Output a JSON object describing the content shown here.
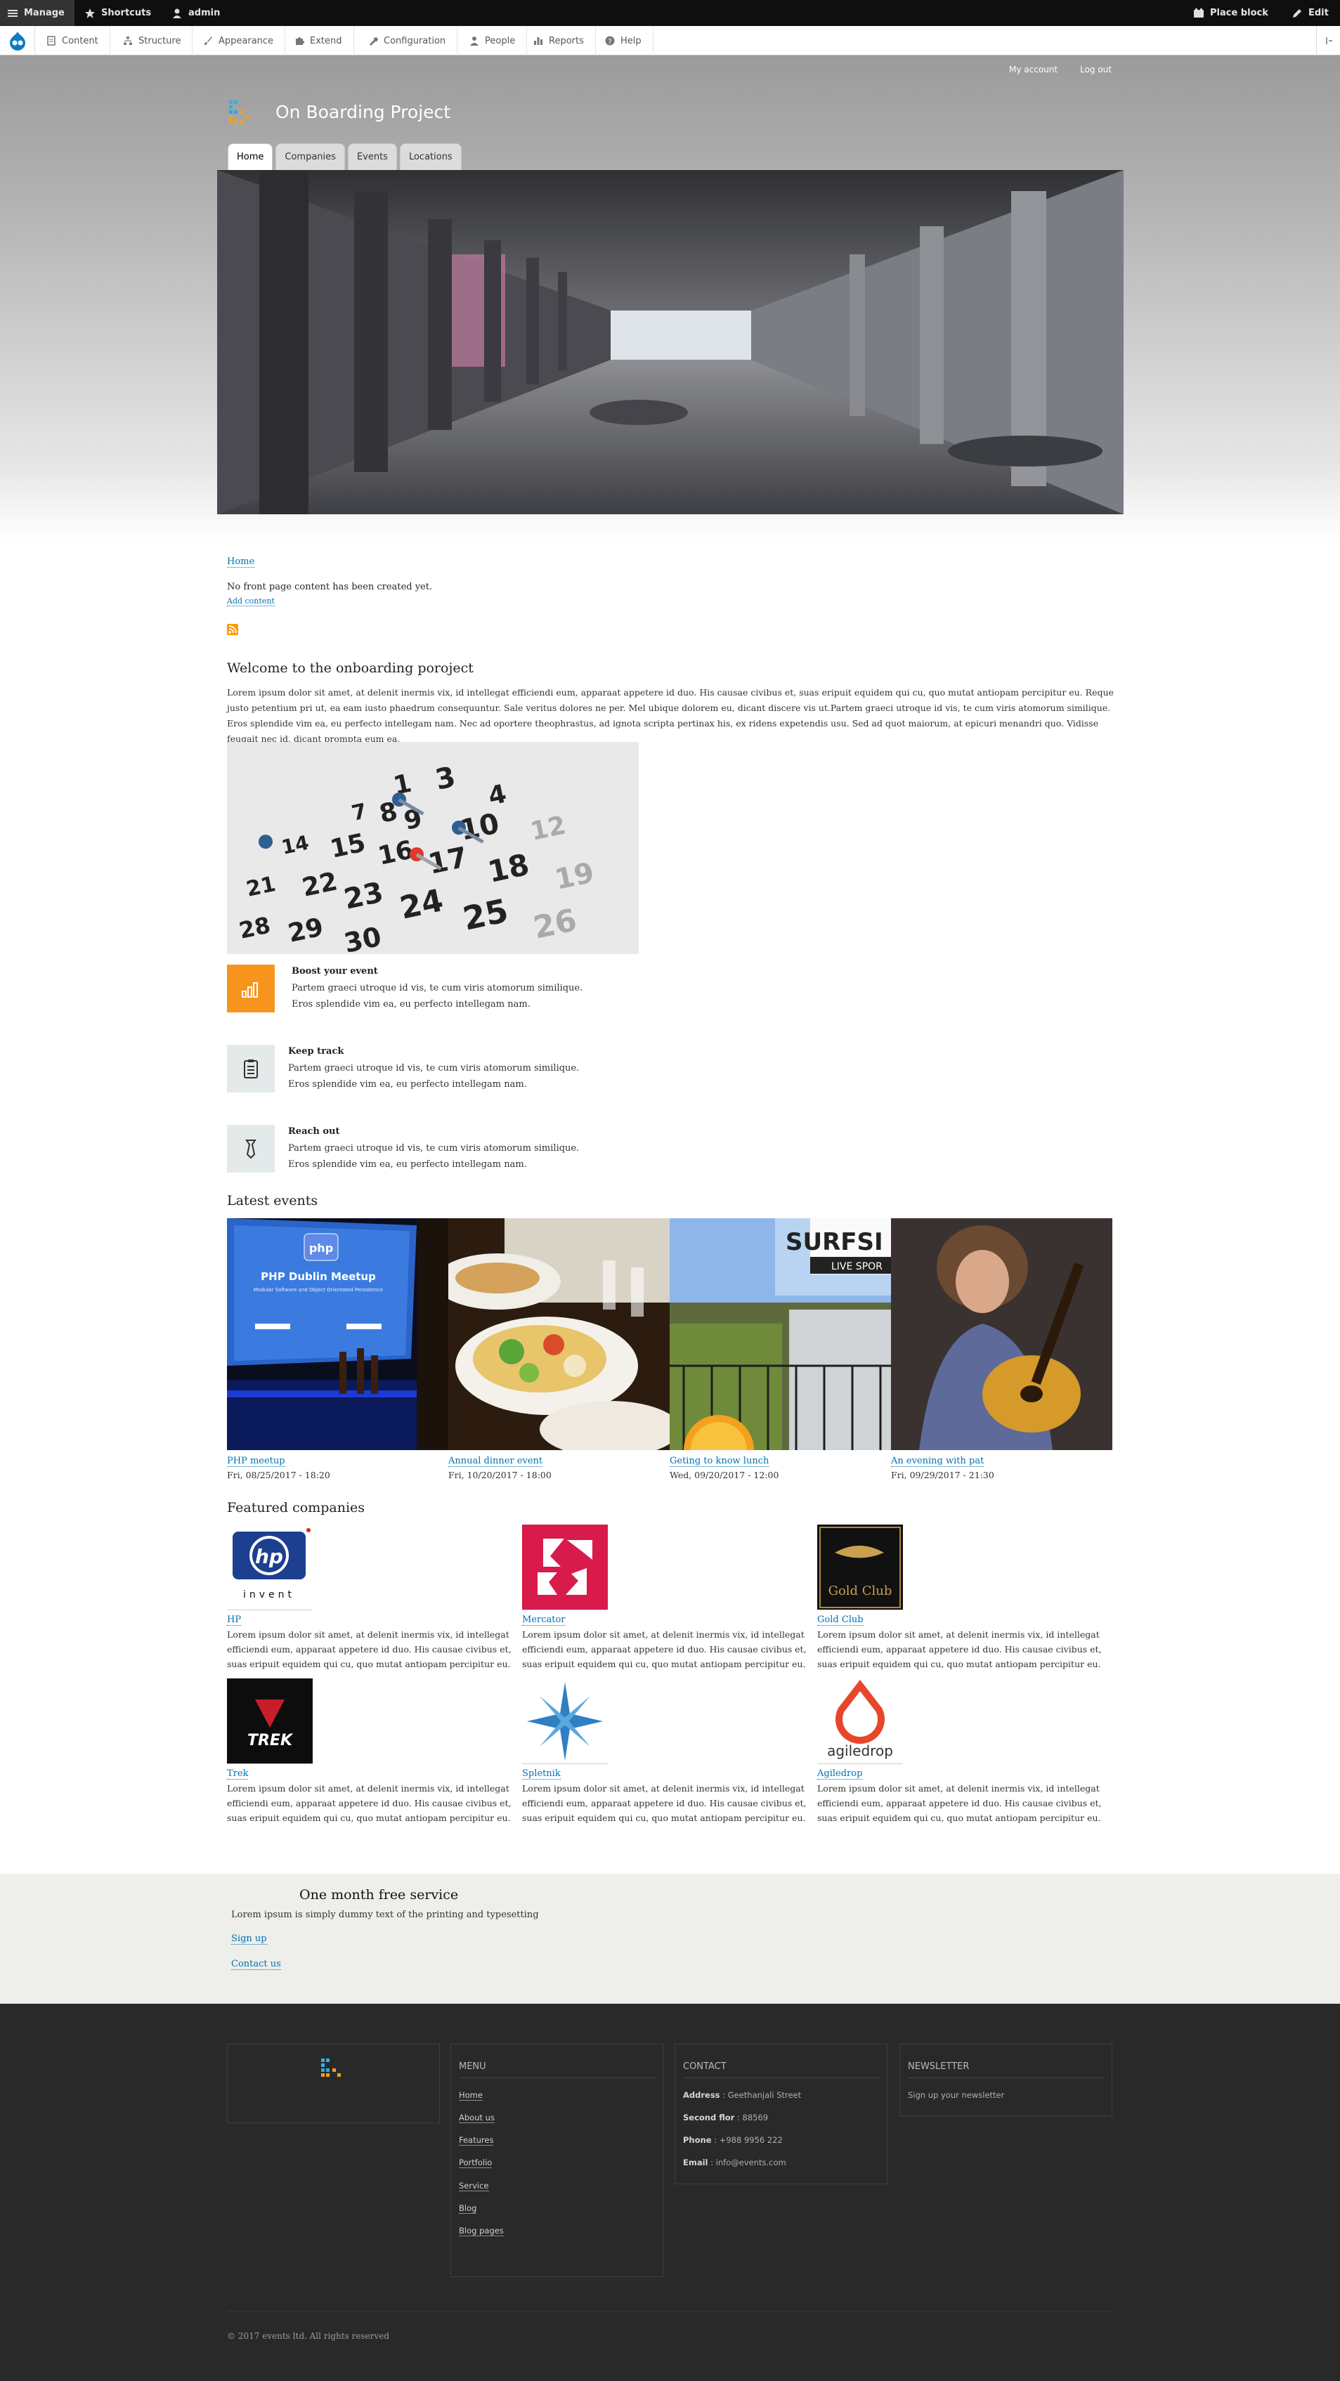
{
  "toolbar": {
    "manage": "Manage",
    "shortcuts": "Shortcuts",
    "user": "admin",
    "place_block": "Place block",
    "edit": "Edit"
  },
  "tray": {
    "items": [
      "Content",
      "Structure",
      "Appearance",
      "Extend",
      "Configuration",
      "People",
      "Reports",
      "Help"
    ]
  },
  "header": {
    "secondary_menu": [
      "My account",
      "Log out"
    ],
    "site_name": "On Boarding Project",
    "tabs": [
      "Home",
      "Companies",
      "Events",
      "Locations"
    ]
  },
  "main": {
    "breadcrumb": "Home",
    "no_content": "No front page content has been created yet.",
    "add_content": "Add content",
    "welcome_title": "Welcome to the onboarding poroject",
    "welcome_body": "Lorem ipsum dolor sit amet, at delenit inermis vix, id intellegat efficiendi eum, apparaat appetere id duo. His causae civibus et, suas eripuit equidem qui cu, quo mutat antiopam percipitur eu. Reque justo petentium pri ut, ea eam iusto phaedrum consequuntur. Sale veritus dolores ne per. Mel ubique dolorem eu, dicant discere vis ut.Partem graeci utroque id vis, te cum viris atomorum similique. Eros splendide vim ea, eu perfecto intellegam nam. Nec ad oportere theophrastus, ad ignota scripta pertinax his, ex ridens expetendis usu. Sed ad quot maiorum, at epicuri menandri quo. Vidisse feugait nec id, dicant prompta eum ea.",
    "features": [
      {
        "title": "Boost your event",
        "line1": "Partem graeci utroque id vis, te cum viris atomorum similique.",
        "line2": "Eros splendide vim ea, eu perfecto intellegam nam."
      },
      {
        "title": "Keep track",
        "line1": "Partem graeci utroque id vis, te cum viris atomorum similique.",
        "line2": "Eros splendide vim ea, eu perfecto intellegam nam."
      },
      {
        "title": "Reach out",
        "line1": "Partem graeci utroque id vis, te cum viris atomorum similique.",
        "line2": "Eros splendide vim ea, eu perfecto intellegam nam."
      }
    ],
    "latest_events_title": "Latest events",
    "events": [
      {
        "name": "PHP meetup",
        "date": "Fri, 08/25/2017 - 18:20"
      },
      {
        "name": "Annual dinner event",
        "date": "Fri, 10/20/2017 - 18:00"
      },
      {
        "name": "Geting to know lunch",
        "date": "Wed, 09/20/2017 - 12:00"
      },
      {
        "name": "An evening with pat",
        "date": "Fri, 09/29/2017 - 21:30"
      }
    ],
    "featured_companies_title": "Featured companies",
    "companies": [
      {
        "name": "HP",
        "text": "Lorem ipsum dolor sit amet, at delenit inermis vix, id intellegat efficiendi eum, apparaat appetere id duo. His causae civibus et, suas eripuit equidem qui cu, quo mutat antiopam percipitur eu."
      },
      {
        "name": "Mercator",
        "text": "Lorem ipsum dolor sit amet, at delenit inermis vix, id intellegat efficiendi eum, apparaat appetere id duo. His causae civibus et, suas eripuit equidem qui cu, quo mutat antiopam percipitur eu."
      },
      {
        "name": "Gold Club",
        "text": "Lorem ipsum dolor sit amet, at delenit inermis vix, id intellegat efficiendi eum, apparaat appetere id duo. His causae civibus et, suas eripuit equidem qui cu, quo mutat antiopam percipitur eu."
      },
      {
        "name": "Trek",
        "text": "Lorem ipsum dolor sit amet, at delenit inermis vix, id intellegat efficiendi eum, apparaat appetere id duo. His causae civibus et, suas eripuit equidem qui cu, quo mutat antiopam percipitur eu."
      },
      {
        "name": "Spletnik",
        "text": "Lorem ipsum dolor sit amet, at delenit inermis vix, id intellegat efficiendi eum, apparaat appetere id duo. His causae civibus et, suas eripuit equidem qui cu, quo mutat antiopam percipitur eu."
      },
      {
        "name": "Agiledrop",
        "text": "Lorem ipsum dolor sit amet, at delenit inermis vix, id intellegat efficiendi eum, apparaat appetere id duo. His causae civibus et, suas eripuit equidem qui cu, quo mutat antiopam percipitur eu."
      }
    ],
    "logo_text": {
      "hp_sub": "invent",
      "gold": "Gold Club",
      "trek": "TREK",
      "agile": "agiledrop"
    }
  },
  "promo": {
    "title": "One month free service",
    "text": "Lorem ipsum is simply dummy text of the printing and typesetting",
    "signup": "Sign up",
    "contact": "Contact us"
  },
  "footer": {
    "menu_title": "MENU",
    "menu": [
      "Home",
      "About us",
      "Features",
      "Portfolio",
      "Service",
      "Blog",
      "Blog pages"
    ],
    "contact_title": "CONTACT",
    "address_label": "Address",
    "address": " : Geethanjali Street",
    "second_label": "Second flor",
    "second": " : 88569",
    "phone_label": "Phone",
    "phone": " : +988 9956 222",
    "email_label": "Email",
    "email": " : info@events.com",
    "newsletter_title": "NEWSLETTER",
    "newsletter_text": "Sign up your newsletter",
    "copyright": "© 2017 events ltd. All rights reserved"
  },
  "colors": {
    "accent": "#0071b3",
    "feature_orange": "#f7941d",
    "footer_bg": "#292929",
    "promo_bg": "#eeeeea"
  }
}
